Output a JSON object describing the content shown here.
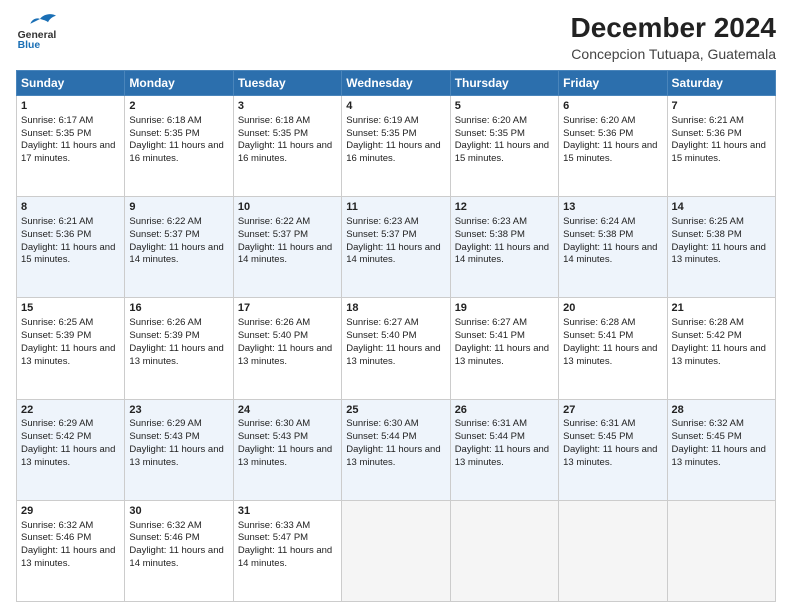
{
  "header": {
    "logo_line1": "General",
    "logo_line2": "Blue",
    "title": "December 2024",
    "subtitle": "Concepcion Tutuapa, Guatemala"
  },
  "days_of_week": [
    "Sunday",
    "Monday",
    "Tuesday",
    "Wednesday",
    "Thursday",
    "Friday",
    "Saturday"
  ],
  "weeks": [
    [
      {
        "day": 1,
        "sunrise": "6:17 AM",
        "sunset": "5:35 PM",
        "daylight": "11 hours and 17 minutes."
      },
      {
        "day": 2,
        "sunrise": "6:18 AM",
        "sunset": "5:35 PM",
        "daylight": "11 hours and 16 minutes."
      },
      {
        "day": 3,
        "sunrise": "6:18 AM",
        "sunset": "5:35 PM",
        "daylight": "11 hours and 16 minutes."
      },
      {
        "day": 4,
        "sunrise": "6:19 AM",
        "sunset": "5:35 PM",
        "daylight": "11 hours and 16 minutes."
      },
      {
        "day": 5,
        "sunrise": "6:20 AM",
        "sunset": "5:35 PM",
        "daylight": "11 hours and 15 minutes."
      },
      {
        "day": 6,
        "sunrise": "6:20 AM",
        "sunset": "5:36 PM",
        "daylight": "11 hours and 15 minutes."
      },
      {
        "day": 7,
        "sunrise": "6:21 AM",
        "sunset": "5:36 PM",
        "daylight": "11 hours and 15 minutes."
      }
    ],
    [
      {
        "day": 8,
        "sunrise": "6:21 AM",
        "sunset": "5:36 PM",
        "daylight": "11 hours and 15 minutes."
      },
      {
        "day": 9,
        "sunrise": "6:22 AM",
        "sunset": "5:37 PM",
        "daylight": "11 hours and 14 minutes."
      },
      {
        "day": 10,
        "sunrise": "6:22 AM",
        "sunset": "5:37 PM",
        "daylight": "11 hours and 14 minutes."
      },
      {
        "day": 11,
        "sunrise": "6:23 AM",
        "sunset": "5:37 PM",
        "daylight": "11 hours and 14 minutes."
      },
      {
        "day": 12,
        "sunrise": "6:23 AM",
        "sunset": "5:38 PM",
        "daylight": "11 hours and 14 minutes."
      },
      {
        "day": 13,
        "sunrise": "6:24 AM",
        "sunset": "5:38 PM",
        "daylight": "11 hours and 14 minutes."
      },
      {
        "day": 14,
        "sunrise": "6:25 AM",
        "sunset": "5:38 PM",
        "daylight": "11 hours and 13 minutes."
      }
    ],
    [
      {
        "day": 15,
        "sunrise": "6:25 AM",
        "sunset": "5:39 PM",
        "daylight": "11 hours and 13 minutes."
      },
      {
        "day": 16,
        "sunrise": "6:26 AM",
        "sunset": "5:39 PM",
        "daylight": "11 hours and 13 minutes."
      },
      {
        "day": 17,
        "sunrise": "6:26 AM",
        "sunset": "5:40 PM",
        "daylight": "11 hours and 13 minutes."
      },
      {
        "day": 18,
        "sunrise": "6:27 AM",
        "sunset": "5:40 PM",
        "daylight": "11 hours and 13 minutes."
      },
      {
        "day": 19,
        "sunrise": "6:27 AM",
        "sunset": "5:41 PM",
        "daylight": "11 hours and 13 minutes."
      },
      {
        "day": 20,
        "sunrise": "6:28 AM",
        "sunset": "5:41 PM",
        "daylight": "11 hours and 13 minutes."
      },
      {
        "day": 21,
        "sunrise": "6:28 AM",
        "sunset": "5:42 PM",
        "daylight": "11 hours and 13 minutes."
      }
    ],
    [
      {
        "day": 22,
        "sunrise": "6:29 AM",
        "sunset": "5:42 PM",
        "daylight": "11 hours and 13 minutes."
      },
      {
        "day": 23,
        "sunrise": "6:29 AM",
        "sunset": "5:43 PM",
        "daylight": "11 hours and 13 minutes."
      },
      {
        "day": 24,
        "sunrise": "6:30 AM",
        "sunset": "5:43 PM",
        "daylight": "11 hours and 13 minutes."
      },
      {
        "day": 25,
        "sunrise": "6:30 AM",
        "sunset": "5:44 PM",
        "daylight": "11 hours and 13 minutes."
      },
      {
        "day": 26,
        "sunrise": "6:31 AM",
        "sunset": "5:44 PM",
        "daylight": "11 hours and 13 minutes."
      },
      {
        "day": 27,
        "sunrise": "6:31 AM",
        "sunset": "5:45 PM",
        "daylight": "11 hours and 13 minutes."
      },
      {
        "day": 28,
        "sunrise": "6:32 AM",
        "sunset": "5:45 PM",
        "daylight": "11 hours and 13 minutes."
      }
    ],
    [
      {
        "day": 29,
        "sunrise": "6:32 AM",
        "sunset": "5:46 PM",
        "daylight": "11 hours and 13 minutes."
      },
      {
        "day": 30,
        "sunrise": "6:32 AM",
        "sunset": "5:46 PM",
        "daylight": "11 hours and 14 minutes."
      },
      {
        "day": 31,
        "sunrise": "6:33 AM",
        "sunset": "5:47 PM",
        "daylight": "11 hours and 14 minutes."
      },
      null,
      null,
      null,
      null
    ]
  ]
}
